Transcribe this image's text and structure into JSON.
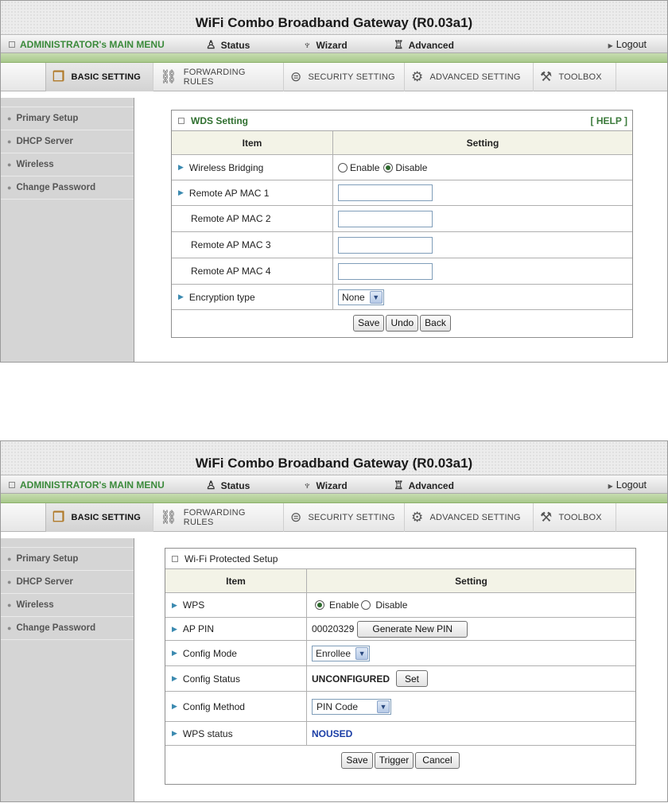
{
  "header": {
    "title": "WiFi Combo Broadband Gateway (R0.03a1)",
    "admin_menu": "ADMINISTRATOR's MAIN MENU",
    "status": "Status",
    "wizard": "Wizard",
    "advanced": "Advanced",
    "logout": "Logout"
  },
  "tabs": {
    "basic": "BASIC SETTING",
    "forwarding": "FORWARDING RULES",
    "security": "SECURITY SETTING",
    "advanced": "ADVANCED SETTING",
    "toolbox": "TOOLBOX"
  },
  "sidebar": {
    "items": [
      {
        "label": "Primary Setup"
      },
      {
        "label": "DHCP Server"
      },
      {
        "label": "Wireless"
      },
      {
        "label": "Change Password"
      }
    ]
  },
  "wds": {
    "title": "WDS Setting",
    "help": "[ HELP ]",
    "col_item": "Item",
    "col_setting": "Setting",
    "bridging_label": "Wireless Bridging",
    "enable": "Enable",
    "disable": "Disable",
    "mac1_label": "Remote AP MAC 1",
    "mac2_label": "Remote AP MAC 2",
    "mac3_label": "Remote AP MAC 3",
    "mac4_label": "Remote AP MAC 4",
    "mac1_value": "",
    "mac2_value": "",
    "mac3_value": "",
    "mac4_value": "",
    "encryption_label": "Encryption type",
    "encryption_value": "None",
    "save": "Save",
    "undo": "Undo",
    "back": "Back"
  },
  "wps": {
    "title": "Wi-Fi Protected Setup",
    "col_item": "Item",
    "col_setting": "Setting",
    "wps_label": "WPS",
    "enable": "Enable",
    "disable": "Disable",
    "pin_label": "AP PIN",
    "pin_value": "00020329",
    "generate": "Generate New PIN",
    "mode_label": "Config Mode",
    "mode_value": "Enrollee",
    "status_label": "Config Status",
    "status_value": "UNCONFIGURED",
    "set": "Set",
    "method_label": "Config Method",
    "method_value": "PIN Code",
    "wps_status_label": "WPS status",
    "wps_status_value": "NOUSED",
    "save": "Save",
    "trigger": "Trigger",
    "cancel": "Cancel"
  },
  "colors": {
    "accent_green": "#3b8a3b",
    "status_blue": "#1b3ea6",
    "sidebar_bg": "#d5d5d5"
  }
}
